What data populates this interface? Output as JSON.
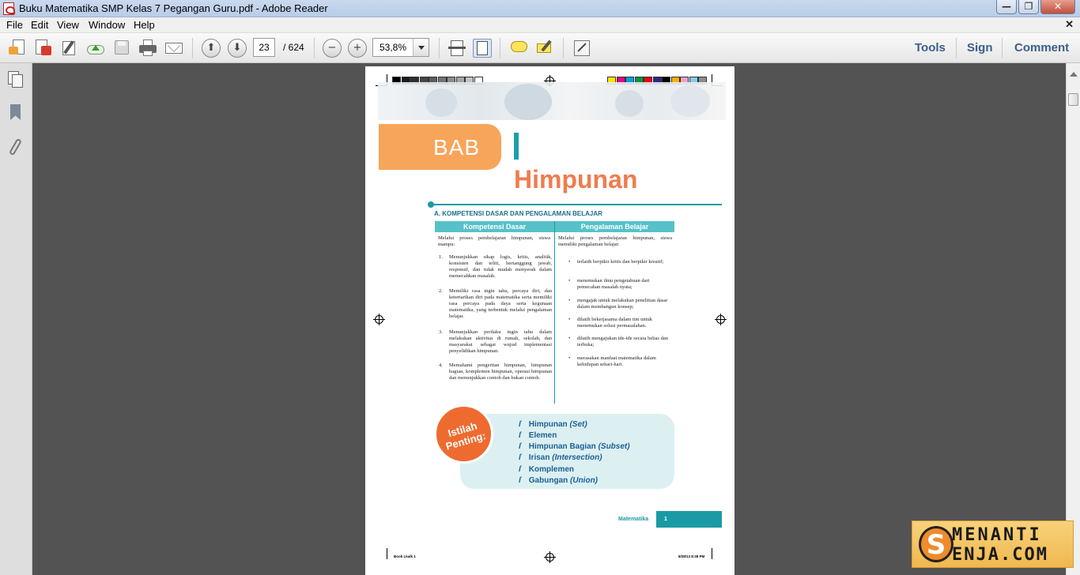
{
  "window": {
    "title": "Buku Matematika SMP Kelas 7 Pegangan Guru.pdf - Adobe Reader",
    "minimize_glyph": "—",
    "maximize_glyph": "❐",
    "close_glyph": "✕"
  },
  "menu": {
    "items": [
      "File",
      "Edit",
      "View",
      "Window",
      "Help"
    ],
    "close_glyph": "✕"
  },
  "toolbar": {
    "page_current": "23",
    "page_total": "/ 624",
    "zoom": "53,8%",
    "right_tools": [
      "Tools",
      "Sign",
      "Comment"
    ]
  },
  "icons": {
    "toolbar": [
      "create-pdf-icon",
      "convert-pdf-icon",
      "edit-pdf-icon",
      "upload-cloud-icon",
      "save-icon",
      "print-icon",
      "email-icon",
      "previous-page-icon",
      "next-page-icon",
      "zoom-out-icon",
      "zoom-in-icon",
      "fit-page-icon",
      "fit-width-icon",
      "comment-icon",
      "highlight-icon",
      "fullscreen-icon"
    ],
    "left_panel": [
      "page-thumbnails-icon",
      "bookmarks-icon",
      "attachments-icon"
    ]
  },
  "document": {
    "chapter_label": "BAB",
    "chapter_title": "Himpunan",
    "section_title": "A. KOMPETENSI DASAR DAN PENGALAMAN BELAJAR",
    "table": {
      "headers": [
        "Kompetensi Dasar",
        "Pengalaman Belajar"
      ],
      "left_intro": "Melalui proses pembelajaran himpunan, siswa mampu:",
      "left_items": [
        {
          "no": "1.",
          "text": "Menunjukkan sikap logis, kritis, analitik, konsisten dan teliti, bertanggung jawab, responsif, dan tidak mudah menyerah dalam memecahkan masalah."
        },
        {
          "no": "2.",
          "text": "Memiliki rasa ingin tahu, percaya diri, dan ketertarikan diri pada matematika serta memiliki rasa percaya pada daya serta kegunaan matematika, yang terbentuk melalui pengalaman belajar."
        },
        {
          "no": "3.",
          "text": "Menunjukkan perilaku ingin tahu dalam melakukan aktivitas di rumah, sekolah, dan masyarakat sebagai wujud implementasi penyelidikan himpunan."
        },
        {
          "no": "4.",
          "text": "Memahami pengertian himpunan, himpunan bagian, komplemen himpunan, operasi himpunan dan menunjukkan contoh dan bukan contoh."
        }
      ],
      "right_intro": "Melalui proses pembelajaran himpunan, siswa memiliki pengalaman belajar:",
      "right_items": [
        "terlatih berpikir kritis dan berpikir kreatif;",
        "menemukan ilmu pengetahuan dari pemecahan masalah nyata;",
        "mengajak untuk melakukan penelitian dasar dalam membangun konsep;",
        "dilatih bekerjasama dalam tim untuk menemukan solusi permasalahan.",
        "dilatih mengajukan ide-ide secara bebas dan terbuka;",
        "merasakan manfaat matematika dalam kehidupan sehari-hari."
      ]
    },
    "istilah": {
      "label": "Istilah Penting:",
      "terms": [
        {
          "id": "Himpunan",
          "en": "(Set)"
        },
        {
          "id": "Elemen",
          "en": ""
        },
        {
          "id": "Himpunan Bagian",
          "en": "(Subset)"
        },
        {
          "id": "Irisan",
          "en": "(Intersection)"
        },
        {
          "id": "Komplemen",
          "en": ""
        },
        {
          "id": "Gabungan",
          "en": "(Union)"
        }
      ]
    },
    "footer_subject": "Matematika",
    "footer_page": "1",
    "slug_left": "Book Lkalk 1",
    "slug_right": "8/28/13  8:38 PM",
    "swatch_colors_gray": [
      "#000000",
      "#1a1a1a",
      "#2e2e2e",
      "#454545",
      "#5c5c5c",
      "#737373",
      "#8c8c8c",
      "#a6a6a6",
      "#c2c2c2",
      "#ffffff"
    ],
    "swatch_colors_cmyk": [
      "#ffe600",
      "#e6007e",
      "#009fe3",
      "#00963f",
      "#e30613",
      "#312783",
      "#000000",
      "#f9b000",
      "#f39fc8",
      "#7fcdee",
      "#8c8c8c"
    ]
  },
  "watermark": {
    "letter": "S",
    "line1": "MENANTI",
    "line2": "ENJA.COM"
  },
  "colors": {
    "accent_teal": "#1a9ba3",
    "accent_orange": "#ef7c4f",
    "tools_blue": "#3b5f8a"
  }
}
